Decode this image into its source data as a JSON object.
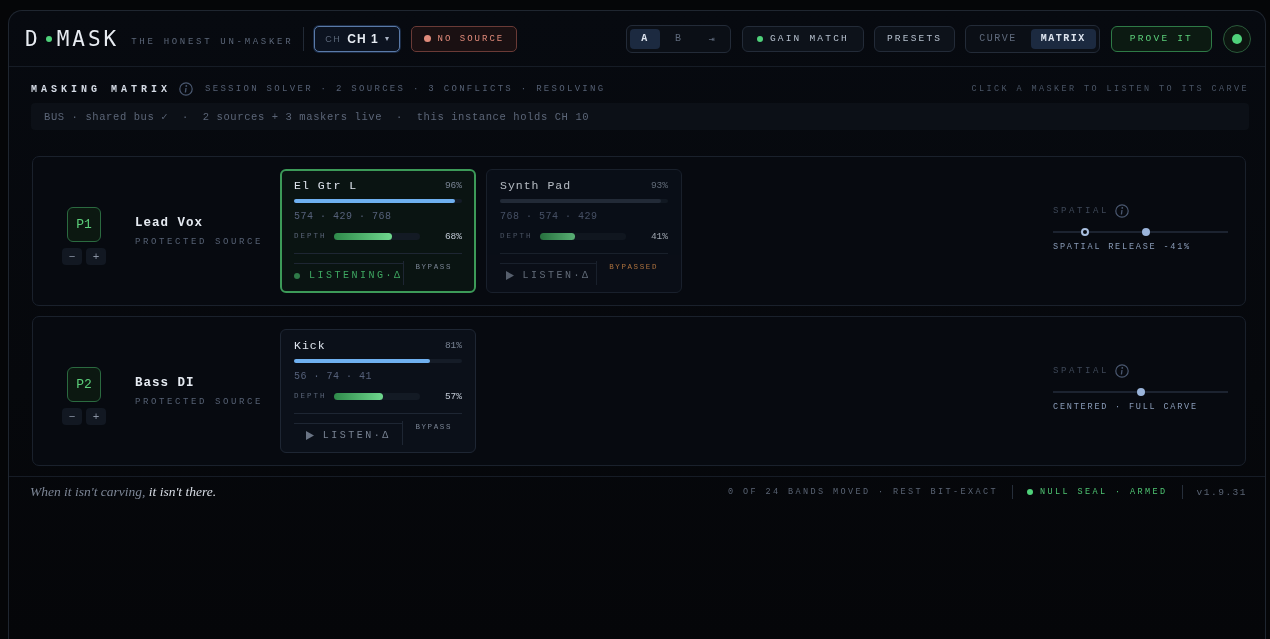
{
  "header": {
    "logo": {
      "left": "D",
      "right": "MASK"
    },
    "tagline": "THE HONEST UN-MASKER",
    "channel": {
      "label": "CH",
      "value": "CH 1",
      "caret": "▾"
    },
    "source_badge": {
      "text": "NO SOURCE",
      "active": false
    },
    "ab": [
      {
        "label": "A",
        "selected": true
      },
      {
        "label": "B",
        "selected": false
      },
      {
        "label": "⇥",
        "selected": false
      }
    ],
    "gain_match": {
      "label": "GAIN MATCH",
      "on": true
    },
    "presets": "PRESETS",
    "views": [
      {
        "label": "CURVE",
        "selected": false
      },
      {
        "label": "MATRIX",
        "selected": true
      }
    ],
    "prove": "PROVE IT",
    "power_on": true
  },
  "section": {
    "title": "MASKING MATRIX",
    "subtitle": "SESSION SOLVER · 2 SOURCES · 3 CONFLICTS · RESOLVING",
    "hint": "CLICK A MASKER TO LISTEN TO ITS CARVE",
    "bus": "BUS · shared bus ✓  ·  2 sources + 3 maskers live  ·  this instance holds CH 10"
  },
  "sources": [
    {
      "badge": "P1",
      "name": "Lead Vox",
      "role": "PROTECTED SOURCE",
      "minus": "−",
      "plus": "+",
      "maskers": [
        {
          "name": "El Gtr L",
          "percent": "96%",
          "level": 0.96,
          "freqs": "574 · 429 · 768",
          "depth_label": "DEPTH",
          "depth": {
            "level": 0.68,
            "reading": "68%"
          },
          "selected": true,
          "listening": true,
          "listen": "LISTENING·Δ",
          "bypassed": false,
          "bypass": "BYPASS"
        },
        {
          "name": "Synth Pad",
          "percent": "93%",
          "level": 0.96,
          "freqs": "768 · 574 · 429",
          "depth_label": "DEPTH",
          "depth": {
            "level": 0.41,
            "reading": "41%"
          },
          "selected": false,
          "listening": false,
          "listen": "LISTEN·Δ",
          "bypassed": true,
          "bypass": "BYPASSED"
        }
      ],
      "spatial": {
        "label": "SPATIAL",
        "markers": [
          {
            "kind": "origin",
            "level": 0.18
          },
          {
            "kind": "current",
            "level": 0.53
          }
        ],
        "reading": "SPATIAL RELEASE -41%"
      }
    },
    {
      "badge": "P2",
      "name": "Bass DI",
      "role": "PROTECTED SOURCE",
      "minus": "−",
      "plus": "+",
      "maskers": [
        {
          "name": "Kick",
          "percent": "81%",
          "level": 0.81,
          "freqs": "56 · 74 · 41",
          "depth_label": "DEPTH",
          "depth": {
            "level": 0.57,
            "reading": "57%"
          },
          "selected": false,
          "listening": false,
          "listen": "LISTEN·Δ",
          "bypassed": false,
          "bypass": "BYPASS"
        }
      ],
      "spatial": {
        "label": "SPATIAL",
        "markers": [
          {
            "kind": "current",
            "level": 0.5
          }
        ],
        "reading": "CENTERED · FULL CARVE"
      }
    }
  ],
  "footer": {
    "tagline_lead": "When it isn't carving,",
    "tagline_emphasis": "it isn't there.",
    "stats": "0 OF 24 BANDS MOVED · REST BIT-EXACT",
    "seal": "NULL SEAL · ARMED",
    "version": "v1.9.31"
  }
}
